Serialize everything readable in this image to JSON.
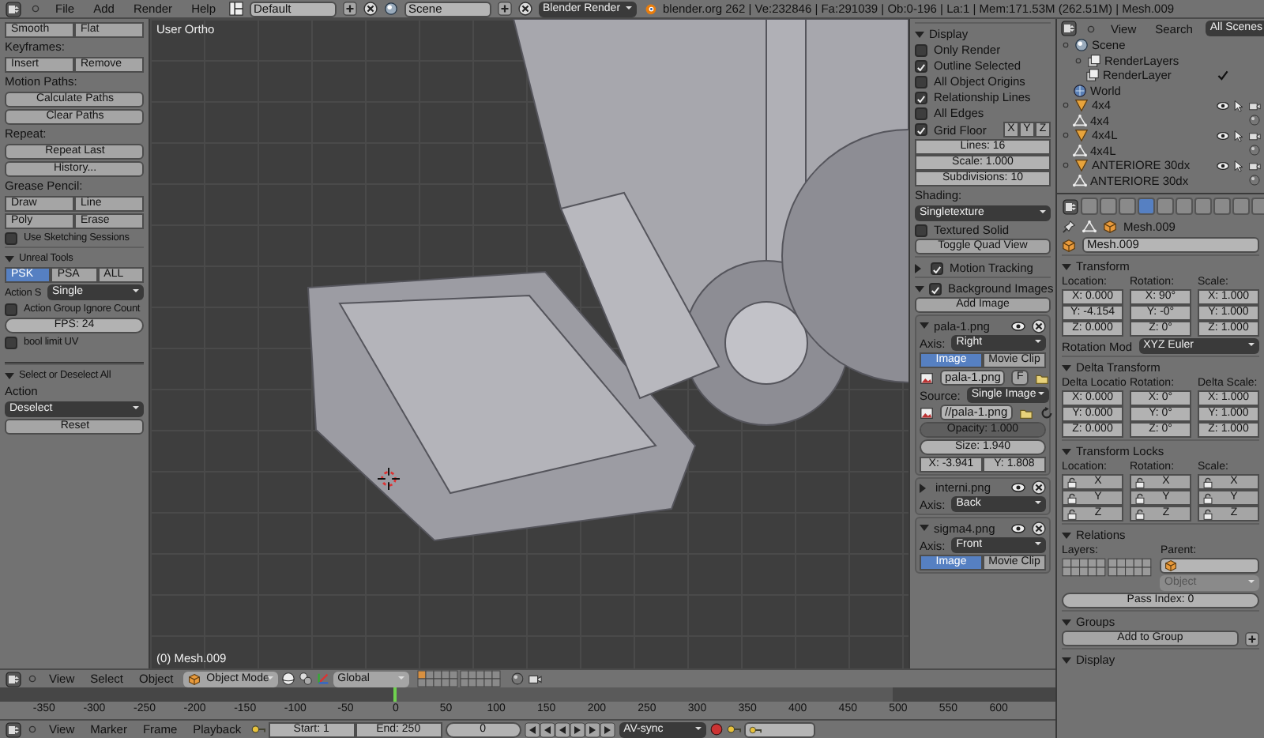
{
  "info_header": {
    "menus": [
      "File",
      "Add",
      "Render",
      "Help"
    ],
    "screen": "Default",
    "scene": "Scene",
    "engine": "Blender Render",
    "stats": "blender.org 262 | Ve:232846 | Fa:291039 | Ob:0-196 | La:1 | Mem:171.53M (262.51M) | Mesh.009"
  },
  "tool_shelf": {
    "rows": [
      {
        "kind": "buttons",
        "items": [
          {
            "label": "Smooth"
          },
          {
            "label": "Flat"
          }
        ]
      },
      {
        "kind": "label",
        "text": "Keyframes:"
      },
      {
        "kind": "buttons",
        "items": [
          {
            "label": "Insert"
          },
          {
            "label": "Remove"
          }
        ]
      },
      {
        "kind": "label",
        "text": "Motion Paths:"
      },
      {
        "kind": "button",
        "text": "Calculate Paths"
      },
      {
        "kind": "button",
        "text": "Clear Paths"
      },
      {
        "kind": "label",
        "text": "Repeat:"
      },
      {
        "kind": "button",
        "text": "Repeat Last"
      },
      {
        "kind": "button",
        "text": "History..."
      },
      {
        "kind": "label",
        "text": "Grease Pencil:"
      },
      {
        "kind": "buttons",
        "items": [
          {
            "label": "Draw"
          },
          {
            "label": "Line"
          }
        ]
      },
      {
        "kind": "buttons",
        "items": [
          {
            "label": "Poly"
          },
          {
            "label": "Erase"
          }
        ]
      },
      {
        "kind": "checkbox",
        "label": "Use Sketching Sessions",
        "checked": false
      },
      {
        "kind": "header",
        "text": "Unreal Tools",
        "expanded": true
      },
      {
        "kind": "buttons",
        "items": [
          {
            "label": "PSK",
            "selected": true
          },
          {
            "label": "PSA",
            "selected": false
          },
          {
            "label": "ALL",
            "selected": false
          }
        ]
      },
      {
        "kind": "dropdown",
        "label": "Action S",
        "value": "Single"
      },
      {
        "kind": "checkbox",
        "label": "Action Group Ignore Count",
        "checked": false
      },
      {
        "kind": "number",
        "text": "FPS: 24"
      },
      {
        "kind": "checkbox",
        "label": "bool limit UV",
        "checked": false
      }
    ]
  },
  "operator_panel": {
    "rows": [
      {
        "kind": "header",
        "text": "Select or Deselect All",
        "expanded": true
      },
      {
        "kind": "label",
        "text": "Action"
      },
      {
        "kind": "dropdown",
        "value": "Deselect"
      },
      {
        "kind": "button",
        "text": "Reset"
      }
    ]
  },
  "viewport": {
    "view_name": "User Ortho",
    "object_info": "(0) Mesh.009"
  },
  "properties_shelf": {
    "rows": [
      {
        "kind": "header",
        "text": "Display",
        "expanded": true
      },
      {
        "kind": "checkbox",
        "label": "Only Render",
        "checked": false
      },
      {
        "kind": "checkbox",
        "label": "Outline Selected",
        "checked": true
      },
      {
        "kind": "checkbox",
        "label": "All Object Origins",
        "checked": false
      },
      {
        "kind": "checkbox",
        "label": "Relationship Lines",
        "checked": true
      },
      {
        "kind": "checkbox",
        "label": "All Edges",
        "checked": false
      },
      {
        "kind": "checkbox",
        "label": "Grid Floor",
        "checked": true,
        "buttons": [
          "X",
          "Y",
          "Z"
        ]
      },
      {
        "kind": "numbers",
        "items": [
          "Lines: 16",
          "Scale: 1.000",
          "Subdivisions: 10"
        ]
      },
      {
        "kind": "label",
        "text": "Shading:"
      },
      {
        "kind": "dropdown",
        "value": "Singletexture"
      },
      {
        "kind": "checkbox",
        "label": "Textured Solid",
        "checked": false
      },
      {
        "kind": "button",
        "text": "Toggle Quad View"
      },
      {
        "kind": "header",
        "text": "Motion Tracking",
        "expanded": false,
        "checked": true
      },
      {
        "kind": "header",
        "text": "Background Images",
        "expanded": true,
        "checked": true
      },
      {
        "kind": "button",
        "text": "Add Image"
      },
      {
        "kind": "image_entry",
        "name": "pala-1.png",
        "expanded": true,
        "rows": [
          {
            "kind": "dropdown",
            "label": "Axis:",
            "value": "Right"
          },
          {
            "kind": "buttons",
            "items": [
              {
                "label": "Image",
                "selected": true
              },
              {
                "label": "Movie Clip",
                "selected": false
              }
            ]
          },
          {
            "kind": "file",
            "value": "pala-1.png",
            "flag": "F"
          },
          {
            "kind": "dropdown",
            "label": "Source:",
            "value": "Single Image"
          },
          {
            "kind": "file",
            "value": "//pala-1.png"
          },
          {
            "kind": "slider",
            "text": "Opacity: 1.000",
            "level": 1
          },
          {
            "kind": "number",
            "text": "Size: 1.940"
          },
          {
            "kind": "numrow",
            "items": [
              "X: -3.941",
              "Y: 1.808"
            ]
          }
        ]
      },
      {
        "kind": "image_entry",
        "name": "interni.png",
        "expanded": false,
        "rows": [
          {
            "kind": "dropdown",
            "label": "Axis:",
            "value": "Back"
          }
        ]
      },
      {
        "kind": "image_entry",
        "name": "sigma4.png",
        "expanded": true,
        "rows": [
          {
            "kind": "dropdown",
            "label": "Axis:",
            "value": "Front"
          },
          {
            "kind": "buttons",
            "items": [
              {
                "label": "Image",
                "selected": true
              },
              {
                "label": "Movie Clip",
                "selected": false
              }
            ]
          }
        ]
      }
    ]
  },
  "outliner": {
    "menus": [
      "View",
      "Search"
    ],
    "display_mode": "All Scenes",
    "tree": [
      {
        "label": "Scene",
        "kind": "scene",
        "children": [
          {
            "label": "RenderLayers",
            "kind": "renderlayers",
            "children": [
              {
                "label": "RenderLayer",
                "kind": "renderlayer"
              }
            ]
          },
          {
            "label": "World",
            "kind": "world"
          }
        ]
      },
      {
        "label": "4x4",
        "kind": "object",
        "children": [
          {
            "label": "4x4",
            "kind": "mesh"
          }
        ]
      },
      {
        "label": "4x4L",
        "kind": "object",
        "children": [
          {
            "label": "4x4L",
            "kind": "mesh"
          }
        ]
      },
      {
        "label": "ANTERIORE 30dx",
        "kind": "object",
        "children": [
          {
            "label": "ANTERIORE 30dx",
            "kind": "mesh"
          }
        ]
      }
    ]
  },
  "properties": {
    "tabs": [
      {
        "selected": false
      },
      {
        "selected": false
      },
      {
        "selected": false
      },
      {
        "selected": true
      },
      {
        "selected": false
      },
      {
        "selected": false
      },
      {
        "selected": false
      },
      {
        "selected": false
      },
      {
        "selected": false
      },
      {
        "selected": false
      }
    ],
    "rows": [
      {
        "kind": "breadcrumb",
        "value": "Mesh.009"
      },
      {
        "kind": "namefield",
        "value": "Mesh.009"
      },
      {
        "kind": "header",
        "text": "Transform",
        "expanded": true
      },
      {
        "kind": "columns",
        "columns": [
          {
            "title": "Location:",
            "fields": [
              "X: 0.000",
              "Y: -4.154",
              "Z: 0.000"
            ]
          },
          {
            "title": "Rotation:",
            "fields": [
              "X: 90°",
              "Y: -0°",
              "Z: 0°"
            ]
          },
          {
            "title": "Scale:",
            "fields": [
              "X: 1.000",
              "Y: 1.000",
              "Z: 1.000"
            ]
          }
        ]
      },
      {
        "kind": "dropdown",
        "label": "Rotation Mod",
        "value": "XYZ Euler"
      },
      {
        "kind": "header",
        "text": "Delta Transform",
        "expanded": true
      },
      {
        "kind": "columns",
        "columns": [
          {
            "title": "Delta Locatio",
            "fields": [
              "X: 0.000",
              "Y: 0.000",
              "Z: 0.000"
            ]
          },
          {
            "title": "Rotation:",
            "fields": [
              "X: 0°",
              "Y: 0°",
              "Z: 0°"
            ]
          },
          {
            "title": "Delta Scale:",
            "fields": [
              "X: 1.000",
              "Y: 1.000",
              "Z: 1.000"
            ]
          }
        ]
      },
      {
        "kind": "header",
        "text": "Transform Locks",
        "expanded": true
      },
      {
        "kind": "locks",
        "columns": [
          {
            "title": "Location:",
            "fields": [
              "X",
              "Y",
              "Z"
            ]
          },
          {
            "title": "Rotation:",
            "fields": [
              "X",
              "Y",
              "Z"
            ]
          },
          {
            "title": "Scale:",
            "fields": [
              "X",
              "Y",
              "Z"
            ]
          }
        ]
      },
      {
        "kind": "header",
        "text": "Relations",
        "expanded": true
      },
      {
        "kind": "relations",
        "layers_label": "Layers:",
        "parent_label": "Parent:",
        "parent_type": {
          "value": "Object",
          "disabled": true
        }
      },
      {
        "kind": "number",
        "text": "Pass Index: 0"
      },
      {
        "kind": "header",
        "text": "Groups",
        "expanded": true
      },
      {
        "kind": "button_plus",
        "text": "Add to Group"
      },
      {
        "kind": "header",
        "text": "Display",
        "expanded": true
      }
    ]
  },
  "view3d_header": {
    "menus": [
      "View",
      "Select",
      "Object"
    ],
    "mode": "Object Mode",
    "orientation": "Global"
  },
  "timeline": {
    "ruler": [
      "-350",
      "-300",
      "-250",
      "-200",
      "-150",
      "-100",
      "-50",
      "0",
      "50",
      "100",
      "150",
      "200",
      "250",
      "300",
      "350",
      "400",
      "450",
      "500",
      "550",
      "600"
    ],
    "menus": [
      "View",
      "Marker",
      "Frame",
      "Playback"
    ],
    "start": "Start: 1",
    "end": "End: 250",
    "current": "0",
    "sync": "AV-sync"
  }
}
